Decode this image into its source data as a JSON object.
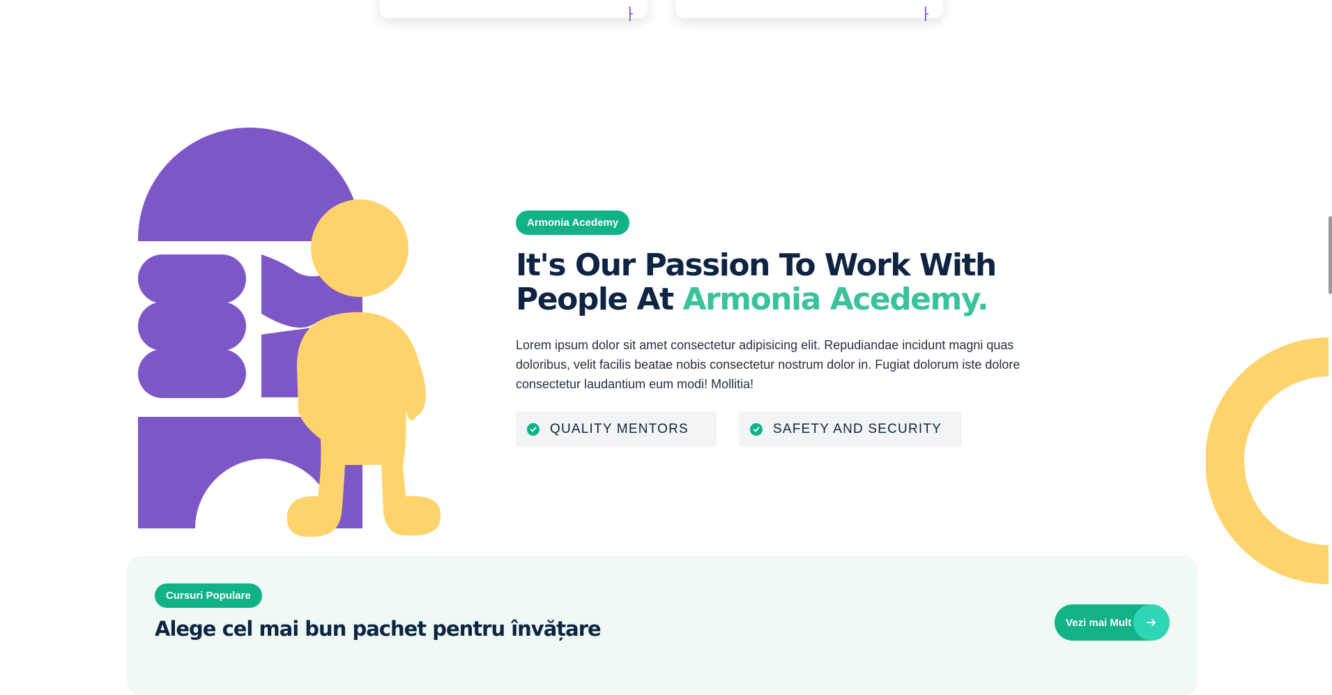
{
  "about": {
    "badge": "Armonia Acedemy",
    "title_part1": "It's Our Passion To Work With People At ",
    "title_accent": "Armonia Acedemy.",
    "description": "Lorem ipsum dolor sit amet consectetur adipisicing elit. Repudiandae incidunt magni quas doloribus, velit facilis beatae nobis consectetur nostrum dolor in. Fugiat dolorum iste dolore consectetur laudantium eum modi! Mollitia!",
    "features": [
      {
        "label": "QUALITY MENTORS",
        "icon": "check-circle-icon"
      },
      {
        "label": "SAFETY AND SECURITY",
        "icon": "check-circle-icon"
      }
    ]
  },
  "courses": {
    "badge": "Cursuri Populare",
    "title": "Alege cel mai bun pachet pentru învățare",
    "see_more_label": "Vezi mai Mult",
    "see_more_icon": "arrow-right-icon"
  },
  "colors": {
    "primary": "#10b286",
    "accent_text": "#3ac29d",
    "heading": "#0e2442",
    "purple": "#7e57c6",
    "yellow": "#ffd36b",
    "section_bg": "#eefaf3"
  }
}
